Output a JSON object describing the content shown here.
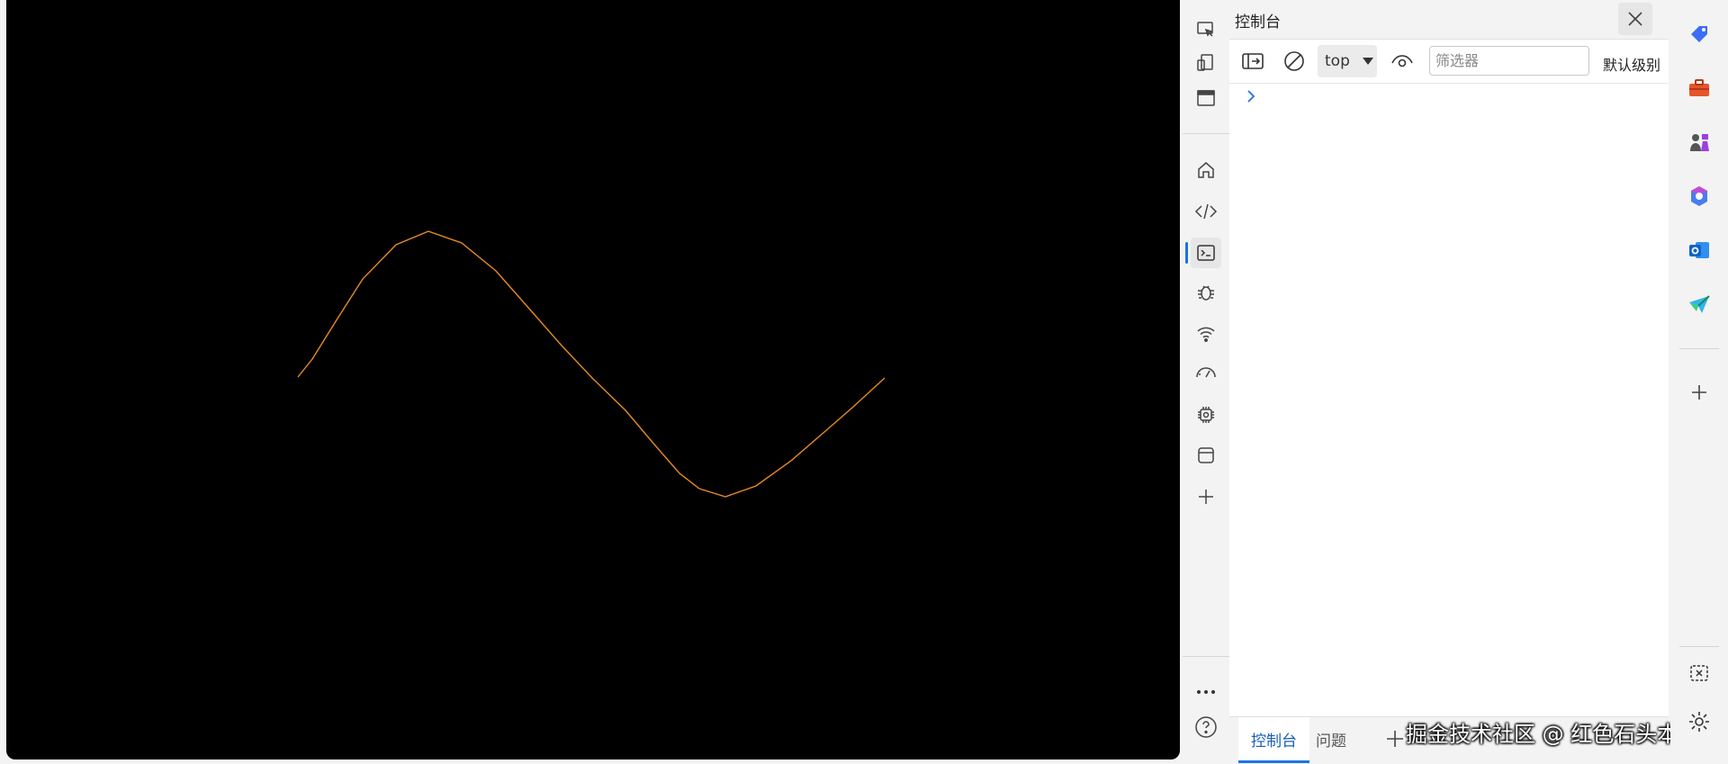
{
  "panel": {
    "title": "控制台",
    "context": "top",
    "filter_placeholder": "筛选器",
    "level_label": "默认级别"
  },
  "bottom_tabs": [
    {
      "label": "控制台",
      "active": true
    },
    {
      "label": "问题",
      "active": false
    }
  ],
  "watermark": "掘金技术社区 @ 红色石头本尊",
  "colors": {
    "axis_x": "#ff2a1a",
    "axis_y": "#33dd33",
    "axis_z": "#2a5bff",
    "curve": "#ff9a2a",
    "accent": "#1a73e8"
  },
  "toolbar_icons": [
    "inspect-icon",
    "device-emulation-icon",
    "panel-toggle-icon",
    "home-icon",
    "elements-icon",
    "console-icon",
    "bug-icon",
    "wifi-icon",
    "performance-icon",
    "memory-chip-icon",
    "application-icon",
    "add-tool-icon",
    "more-icon",
    "help-icon"
  ],
  "sidebar_icons": [
    "tag-icon",
    "toolbox-icon",
    "games-icon",
    "copilot-icon",
    "outlook-icon",
    "send-icon",
    "add-icon",
    "screenshot-icon",
    "settings-icon"
  ]
}
